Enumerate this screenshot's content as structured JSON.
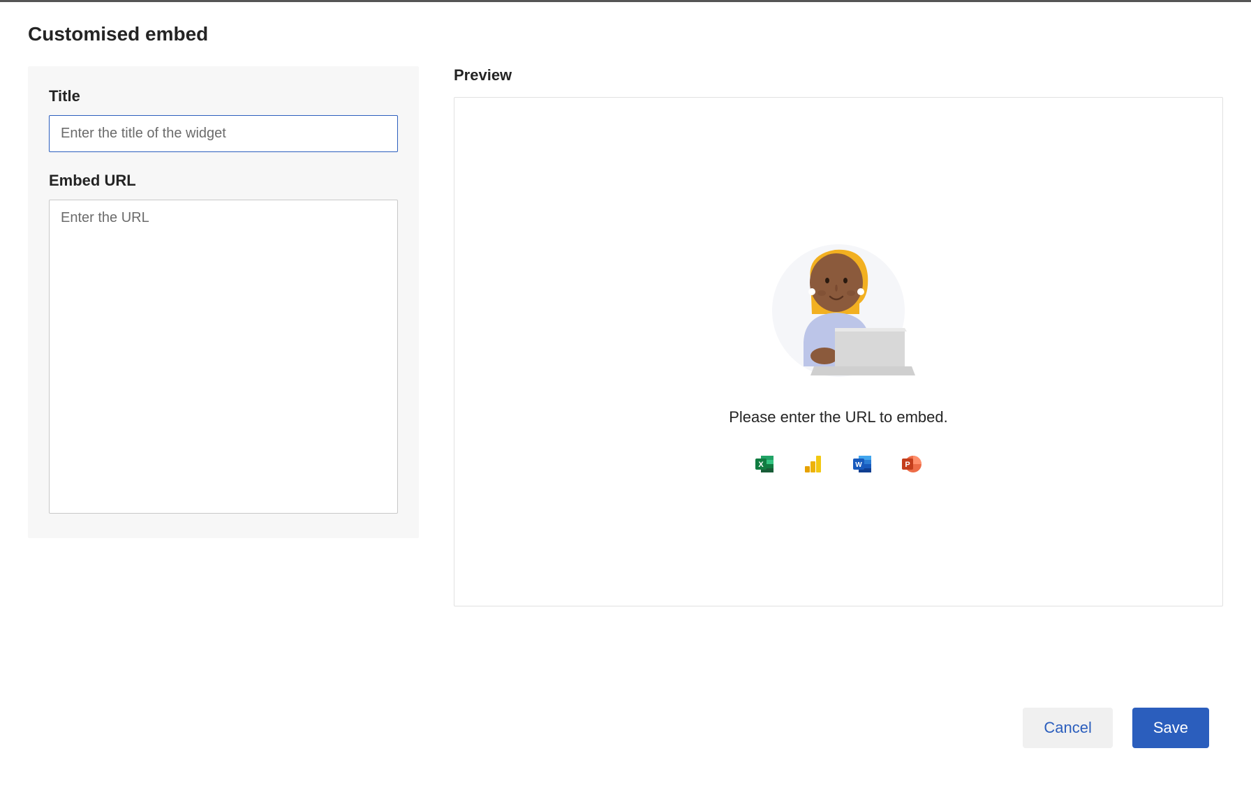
{
  "header": {
    "title": "Customised embed"
  },
  "form": {
    "title_label": "Title",
    "title_placeholder": "Enter the title of the widget",
    "title_value": "",
    "url_label": "Embed URL",
    "url_placeholder": "Enter the URL",
    "url_value": ""
  },
  "preview": {
    "label": "Preview",
    "message": "Please enter the URL to embed.",
    "app_icons": [
      "excel",
      "powerbi",
      "word",
      "powerpoint"
    ]
  },
  "footer": {
    "cancel_label": "Cancel",
    "save_label": "Save"
  }
}
